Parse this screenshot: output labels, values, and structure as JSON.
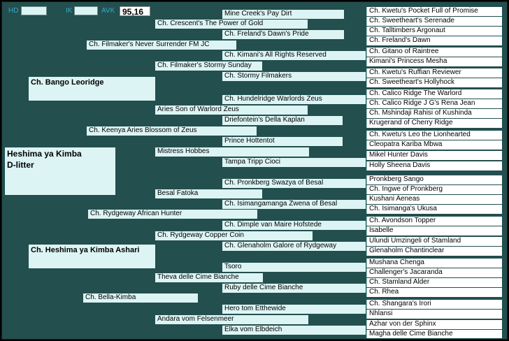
{
  "header": {
    "hd_label": "HD",
    "ik_label": "IK",
    "avk_label": "AVK",
    "avk_value": "95,16"
  },
  "subject": {
    "line1": "Heshima ya Kimba",
    "line2": "D-litter"
  },
  "parents": {
    "sire": "Ch. Bango Leoridge",
    "dam": "Ch. Heshima ya Kimba Ashari"
  },
  "grandparents": [
    "Ch. Filmaker's Never Surrender FM JC",
    "Ch. Keenya Aries Blossom of Zeus",
    "Ch. Rydgeway African Hunter",
    "Ch. Bella-Kimba"
  ],
  "gen3": [
    "Ch. Crescent's The Power of Gold",
    "Ch. Filmaker's Stormy Sunday",
    "Aries Son of Warlord Zeus",
    "Mistress Hobbes",
    "Besal Fatoka",
    "Ch. Rydgeway Copper Coin",
    "Theva delle Cime Bianche",
    "Andara vom Felsenmeer"
  ],
  "gen4": [
    "Mine Creek's Pay Dirt",
    "Ch. Freland's Dawn's Pride",
    "Ch. Kimani's All Rights Reserved",
    "Ch. Stormy Filmakers",
    "Ch. Hundelridge Warlords Zeus",
    "Driefontein's Della Kaplan",
    "Prince Hottentot",
    "Tampa Tripp Cioci",
    "Ch. Pronkberg Swazya of Besal",
    "Ch. Isimangamanga Zwena of Besal",
    "Ch. Dimple van Maire Hofstede",
    "Ch. Glenaholm Galore of Rydgeway",
    "Tsoro",
    "Ruby delle Cime Bianche",
    "Hero tom Etthewide",
    "Elka vom Elbdeich"
  ],
  "gen5": [
    "Ch. Kwetu's Pocket Full of Promise",
    "Ch. Sweetheart's Serenade",
    "Ch. Talltimbers Argonaut",
    "Ch. Freland's Dawn",
    "Ch. Gitano of Raintree",
    "Kimani's Princess Mesha",
    "Ch. Kwetu's Ruffian Reviewer",
    "Ch. Sweetheart's Hollyhock",
    "Ch. Calico Ridge The Warlord",
    "Ch. Calico Ridge J G's Rena Jean",
    "Ch. Mshindaji Rahisi of Kushinda",
    "Krugerand of Cherry Ridge",
    "Ch. Kwetu's Leo the Lionhearted",
    "Cleopatra Kariba Mbwa",
    "Mikel Hunter Davis",
    "Holly Sheena Davis",
    "Pronkberg Sango",
    "Ch. Ingwe of Pronkberg",
    "Kushani Aeneas",
    "Ch. Isimanga's Ukusa",
    "Ch. Avondson Topper",
    "Isabelle",
    "Ulundi Umzingeli of Stamland",
    "Glenaholm Chantinclear",
    "Mushana Chenga",
    "Challenger's Jacaranda",
    "Ch. Stamland Alder",
    "Ch. Rhea",
    "Ch. Shangara's Irori",
    "Nhlansi",
    "Azhar von der Sphinx",
    "Magha delle Cime Bianche"
  ]
}
